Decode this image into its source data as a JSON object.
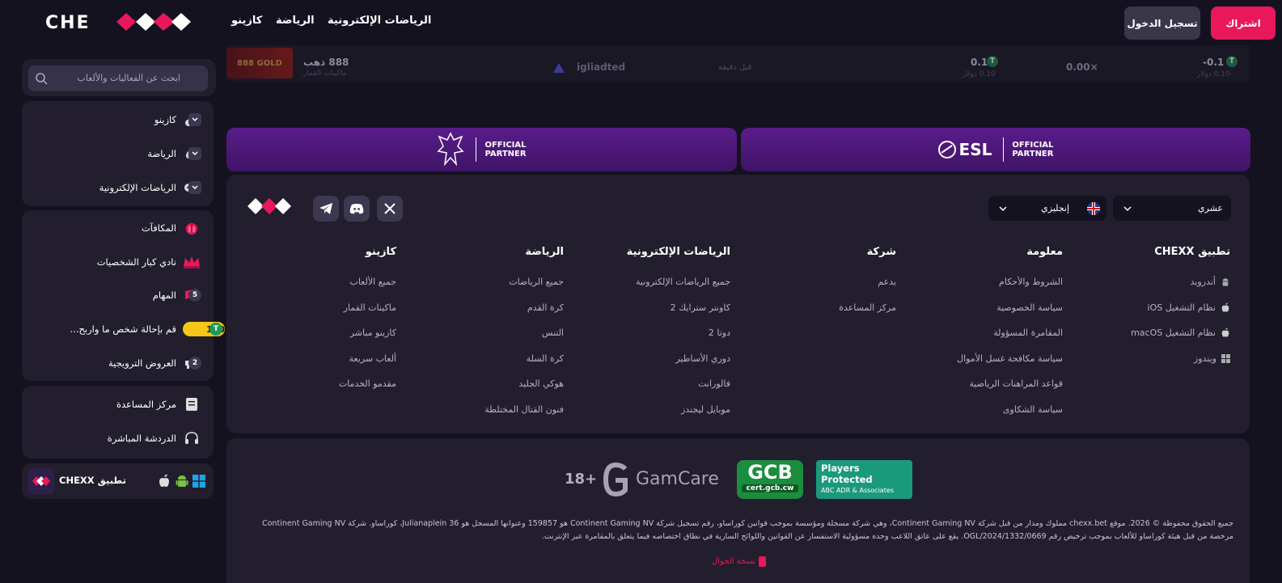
{
  "header": {
    "logo_text": "CHEXX",
    "nav": [
      "الرياضات الإلكترونية",
      "الرياضة",
      "كازينو"
    ],
    "login_label": "تسجيل الدخول",
    "register_label": "اشتراك",
    "colors": {
      "accent": "#e8185b",
      "bg": "#15121f"
    }
  },
  "sidebar": {
    "search_placeholder": "ابحث عن الفعاليات والألعاب",
    "groups": [
      {
        "items": [
          {
            "label": "كازينو",
            "icon": "cherries-icon"
          },
          {
            "label": "الرياضة",
            "icon": "rugby-ball-icon"
          },
          {
            "label": "الرياضات الإلكترونية",
            "icon": "gamepad-icon"
          }
        ]
      },
      {
        "items": [
          {
            "label": "المكافآت",
            "icon": "gift-icon"
          },
          {
            "label": "نادي كبار الشخصيات",
            "icon": "crown-icon"
          },
          {
            "label": "المهام",
            "icon": "missions-icon",
            "count": "5"
          },
          {
            "label": "قم بإحالة شخص ما واربح...",
            "icon": "add-user-icon",
            "reward": "100",
            "reward_currency": "T"
          },
          {
            "label": "العروض الترويجية",
            "icon": "megaphone-icon",
            "count": "2"
          }
        ]
      },
      {
        "items": [
          {
            "label": "مركز المساعدة",
            "icon": "book-icon"
          },
          {
            "label": "الدردشة المباشرة",
            "icon": "headset-icon"
          }
        ]
      }
    ],
    "app_label": "تطبيق CHEXX",
    "app_platforms": [
      "apple-icon",
      "android-icon",
      "windows-icon"
    ]
  },
  "bet_row": {
    "game_title": "888 ذهب",
    "game_sub": "ماكينات القمار",
    "game_thumb": "888 GOLD",
    "user": "igliadted",
    "time": "قبل دقيقة",
    "bet_amount": "0.1",
    "bet_sub": "0.10 دولار",
    "multiplier": "0.00×",
    "payout": "-0.1",
    "payout_sub": "-0.10 دولار"
  },
  "partners": [
    {
      "name": "ESL",
      "line1": "OFFICIAL",
      "line2": "PARTNER"
    },
    {
      "name": "Crystal Palace",
      "line1": "OFFICIAL",
      "line2": "PARTNER"
    }
  ],
  "footer": {
    "language": "إنجليزي",
    "odds_format": "عشري",
    "columns": [
      {
        "title": "تطبيق CHEXX",
        "links": [
          "أندرويد",
          "نظام التشغيل iOS",
          "نظام التشغيل macOS",
          "ويندوز"
        ]
      },
      {
        "title": "معلومة",
        "links": [
          "الشروط والأحكام",
          "سياسة الخصوصية",
          "المقامرة المسؤولة",
          "سياسة مكافحة غسل الأموال",
          "قواعد المراهنات الرياضية",
          "سياسة الشكاوى"
        ]
      },
      {
        "title": "شركة",
        "links": [
          "يدعم",
          "مركز المساعدة"
        ]
      },
      {
        "title": "الرياضات الإلكترونية",
        "links": [
          "جميع الرياضات الإلكترونية",
          "كاونتر سترايك 2",
          "دوتا 2",
          "دوري الأساطير",
          "فالورانت",
          "موبايل ليجندز"
        ]
      },
      {
        "title": "الرياضة",
        "links": [
          "جميع الرياضات",
          "كرة القدم",
          "التنس",
          "كرة السلة",
          "هوكي الجليد",
          "فنون القتال المختلطة"
        ]
      },
      {
        "title": "كازينو",
        "links": [
          "جميع الألعاب",
          "ماكينات القمار",
          "كازينو مباشر",
          "ألعاب سريعة",
          "مقدمو الخدمات"
        ]
      }
    ]
  },
  "legal": {
    "age": "18+",
    "gamcare": "GamCare",
    "gcb": "GCB",
    "gcb_sub": "cert.gcb.cw",
    "players_protected": "Players Protected",
    "pp_sub": "ABC ADR & Associates",
    "text": "جميع الحقوق محفوظة © 2026. موقع chexx.bet مملوك ومدار من قبل شركة Continent Gaming NV، وهي شركة مسجلة ومؤسسة بموجب قوانين كوراساو، رقم تسجيل شركة Continent Gaming NV هو 159857 وعنوانها المسجل هو Julianaplein 36، كوراساو. شركة Continent Gaming NV مرخصة من قبل هيئة كوراساو للألعاب بموجب ترخيص رقم OGL/2024/1332/0669. يقع على عاتق اللاعب وحده مسؤولية الاستفسار عن القوانين واللوائح السارية في نطاق اختصاصه فيما يتعلق بالمقامرة عبر الإنترنت.",
    "mobile_version": "نسخة الجوال"
  }
}
